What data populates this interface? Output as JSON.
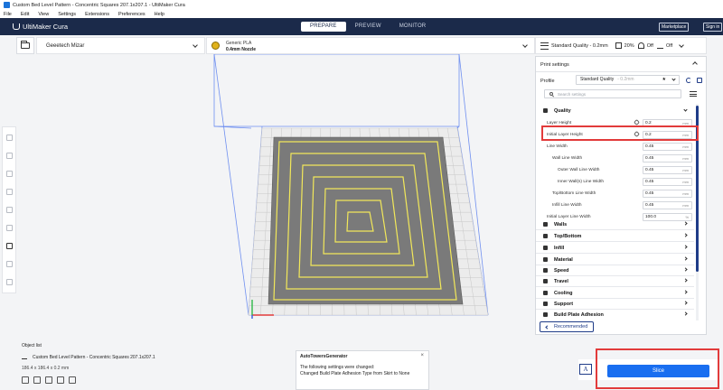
{
  "window": {
    "title": "Custom Bed Level Pattern - Concentric Squares 207.1x207.1 - UltiMaker Cura"
  },
  "menu": [
    "File",
    "Edit",
    "View",
    "Settings",
    "Extensions",
    "Preferences",
    "Help"
  ],
  "header": {
    "logo": "UltiMaker Cura",
    "tabs": [
      "PREPARE",
      "PREVIEW",
      "MONITOR"
    ],
    "active_tab": "PREPARE",
    "marketplace": "Marketplace",
    "signin": "Sign in"
  },
  "toolbar": {
    "printer": "Geeetech Mizar",
    "material_name": "Generic PLA",
    "nozzle": "0.4mm Nozzle",
    "quality": "Standard Quality - 0.2mm",
    "infill": "20%",
    "support": "Off",
    "adhesion": "Off"
  },
  "panel": {
    "title": "Print settings",
    "profile_label": "Profile",
    "profile_value": "Standard Quality",
    "profile_extra": "- 0.2mm",
    "profile_star": "★",
    "search_placeholder": "Search settings",
    "quality_section": "Quality",
    "settings": [
      {
        "label": "Layer Height",
        "value": "0.2",
        "unit": "mm",
        "indent": 0,
        "linked": true
      },
      {
        "label": "Initial Layer Height",
        "value": "0.2",
        "unit": "mm",
        "indent": 0,
        "linked": true
      },
      {
        "label": "Line Width",
        "value": "0.45",
        "unit": "mm",
        "indent": 0,
        "linked": false
      },
      {
        "label": "Wall Line Width",
        "value": "0.45",
        "unit": "mm",
        "indent": 1,
        "linked": false
      },
      {
        "label": "Outer Wall Line Width",
        "value": "0.45",
        "unit": "mm",
        "indent": 2,
        "linked": false
      },
      {
        "label": "Inner Wall(s) Line Width",
        "value": "0.45",
        "unit": "mm",
        "indent": 2,
        "linked": false
      },
      {
        "label": "Top/Bottom Line Width",
        "value": "0.45",
        "unit": "mm",
        "indent": 1,
        "linked": false
      },
      {
        "label": "Infill Line Width",
        "value": "0.45",
        "unit": "mm",
        "indent": 1,
        "linked": false
      },
      {
        "label": "Initial Layer Line Width",
        "value": "100.0",
        "unit": "%",
        "indent": 0,
        "linked": false
      }
    ],
    "sections": [
      "Walls",
      "Top/Bottom",
      "Infill",
      "Material",
      "Speed",
      "Travel",
      "Cooling",
      "Support",
      "Build Plate Adhesion"
    ],
    "recommended": "Recommended"
  },
  "objects": {
    "title": "Object list",
    "name": "Custom Bed Level Pattern - Concentric Squares 207.1x207.1",
    "dims": "186.4 x 186.4 x 0.2 mm"
  },
  "notification": {
    "title": "AutoTowersGenerator",
    "line1": "The following settings were changed:",
    "line2": "Changed Build Plate Adhesion Type from Skirt to None",
    "close": "×"
  },
  "slice": {
    "label": "Slice",
    "a_label": "A"
  },
  "colors": {
    "header": "#1b2a4a",
    "accent": "#196ef0",
    "highlight": "#e23b3b",
    "pattern_line": "#f2e85a",
    "plate_fill": "#7a7a7a"
  }
}
